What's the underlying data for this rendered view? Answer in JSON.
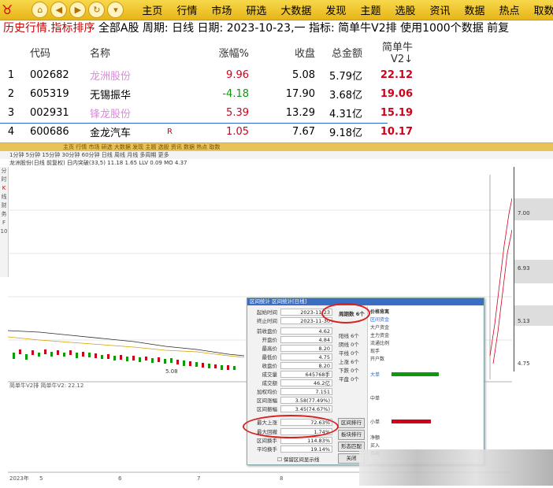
{
  "toolbar": {
    "menu": [
      "主页",
      "行情",
      "市场",
      "研选",
      "大数据",
      "发现",
      "主题",
      "选股",
      "资讯",
      "数据",
      "热点",
      "取数"
    ]
  },
  "title": {
    "part1": "历史行情.指标排序",
    "part2": " 全部A股 周期: 日线 日期: 2023-10-23,一 指标: 简单牛V2排 使用1000个数据 前复"
  },
  "table": {
    "headers": {
      "code": "代码",
      "name": "名称",
      "chg": "涨幅%",
      "close": "收盘",
      "amount": "总金额",
      "v2": "简单牛V2↓"
    },
    "rows": [
      {
        "idx": "1",
        "code": "002682",
        "name": "龙洲股份",
        "flag": "",
        "chg": "9.96",
        "close": "5.08",
        "amount": "5.79亿",
        "v2": "22.12"
      },
      {
        "idx": "2",
        "code": "605319",
        "name": "无锡振华",
        "flag": "",
        "chg": "-4.18",
        "close": "17.90",
        "amount": "3.68亿",
        "v2": "19.06"
      },
      {
        "idx": "3",
        "code": "002931",
        "name": "锋龙股份",
        "flag": "",
        "chg": "5.39",
        "close": "13.29",
        "amount": "4.31亿",
        "v2": "15.19"
      },
      {
        "idx": "4",
        "code": "600686",
        "name": "金龙汽车",
        "flag": "R",
        "chg": "1.05",
        "close": "7.67",
        "amount": "9.18亿",
        "v2": "10.17"
      }
    ]
  },
  "lower": {
    "menu_line": "主页 行情 市场 研选 大数据 发现 主题 选股 资讯 数据 热点 取数",
    "period_line": "1分钟 5分钟 15分钟 30分钟 60分钟 日线 周线 月线 多周期 更多",
    "stock_line": "龙洲股份(日线 前复权) 日内突破(33,5) 11.18 1.65 LLV 0.09 MO 4.37",
    "indicator_label": "简单牛V2排 简单牛V2: 22.12",
    "chart_price_tag": "5.08",
    "right_prices": [
      "7.00",
      "6.93",
      "5.13",
      "4.75"
    ],
    "x_ticks": [
      "2023年",
      "5",
      "6",
      "7",
      "8"
    ]
  },
  "dialog": {
    "title": "区间统计 区间统计[日线]",
    "rows": [
      {
        "label": "起始时间",
        "value": "2023-11-23"
      },
      {
        "label": "终止时间",
        "value": "2023-11-30"
      },
      {
        "label": "前收盘价",
        "value": "4.62"
      },
      {
        "label": "开盘价",
        "value": "4.84"
      },
      {
        "label": "最高价",
        "value": "8.20"
      },
      {
        "label": "最低价",
        "value": "4.75"
      },
      {
        "label": "收盘价",
        "value": "8.20"
      },
      {
        "label": "成交量",
        "value": "645768手"
      },
      {
        "label": "成交额",
        "value": "46.2亿"
      },
      {
        "label": "加权均价",
        "value": "7.151"
      },
      {
        "label": "区间涨幅",
        "value": "3.58(77.49%)"
      },
      {
        "label": "区间振幅",
        "value": "3.45(74.67%)"
      },
      {
        "label": "最大上涨",
        "value": "72.63%"
      },
      {
        "label": "最大回撤",
        "value": "1.74%"
      },
      {
        "label": "区间换手",
        "value": "114.83%"
      },
      {
        "label": "平均换手",
        "value": "19.14%"
      }
    ],
    "period_count": "周期数 6个",
    "mid_items": [
      "阳线 6个",
      "阴线 0个",
      "平线 0个",
      "上涨 6个",
      "下跌 0个",
      "平盘 0个"
    ],
    "buttons": [
      "区间排行",
      "板块排行",
      "形态匹配",
      "关闭"
    ],
    "checkbox": "保留区间显示线",
    "right_lines": [
      "价格背离",
      "区间资金",
      "大户资金",
      "主力资金",
      "流通比例",
      "现手",
      "开户数",
      "大单",
      "中单",
      "小单",
      "净额",
      "买入",
      "卖出"
    ]
  }
}
